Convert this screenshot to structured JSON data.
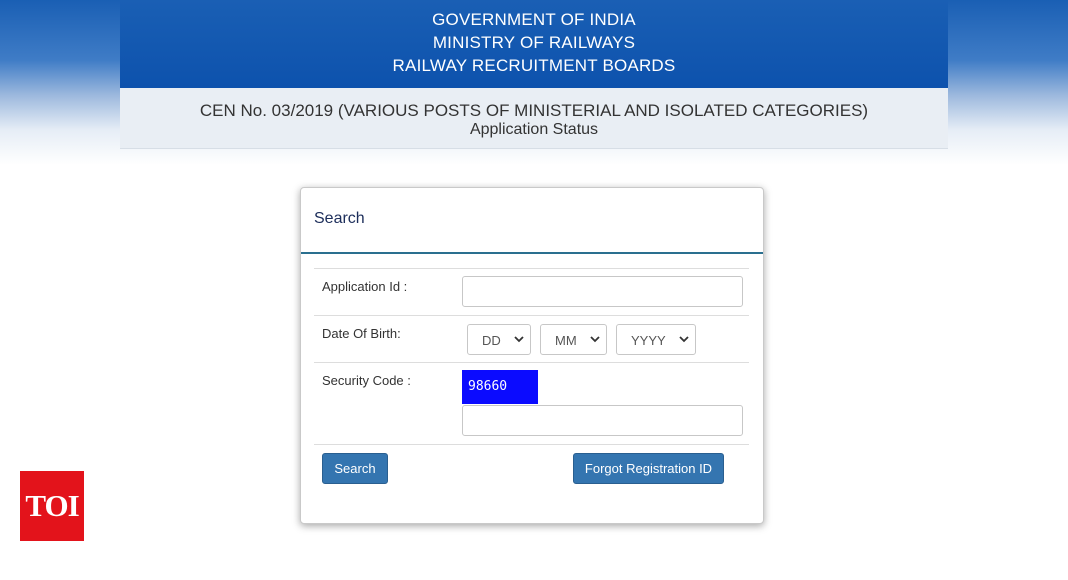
{
  "header": {
    "line1": "GOVERNMENT OF INDIA",
    "line2": "MINISTRY OF RAILWAYS",
    "line3": "RAILWAY RECRUITMENT BOARDS"
  },
  "subheader": {
    "cen": "CEN No. 03/2019 (VARIOUS POSTS OF MINISTERIAL AND ISOLATED CATEGORIES)",
    "status": "Application Status"
  },
  "form": {
    "title": "Search",
    "application_id_label": "Application Id :",
    "application_id_value": "",
    "dob_label": "Date Of Birth:",
    "dob_day": "DD",
    "dob_month": "MM",
    "dob_year": "YYYY",
    "security_label": "Security Code :",
    "captcha_text": "98660",
    "security_value": "",
    "search_button": "Search",
    "forgot_button": "Forgot Registration ID"
  },
  "watermark": {
    "text": "TOI",
    "color": "#e3131b"
  },
  "colors": {
    "header_blue": "#1a5fb4",
    "button_blue": "#3475b0",
    "captcha_blue": "#0b0bff"
  }
}
